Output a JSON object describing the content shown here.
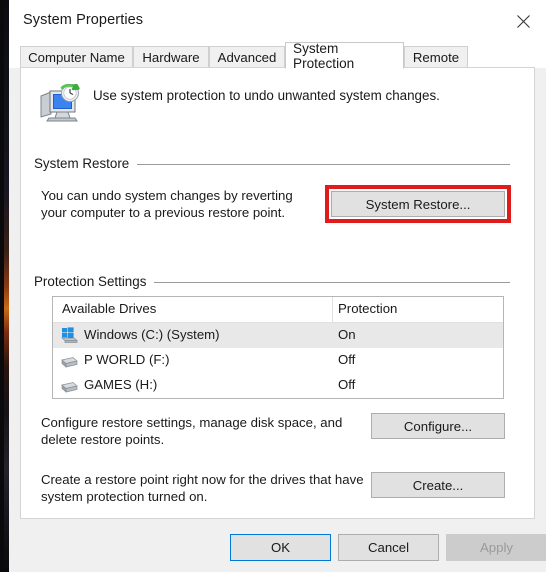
{
  "window": {
    "title": "System Properties",
    "close_icon": "close-icon"
  },
  "tabs": [
    {
      "label": "Computer Name",
      "selected": false
    },
    {
      "label": "Hardware",
      "selected": false
    },
    {
      "label": "Advanced",
      "selected": false
    },
    {
      "label": "System Protection",
      "selected": true
    },
    {
      "label": "Remote",
      "selected": false
    }
  ],
  "header": {
    "icon": "system-protection-icon",
    "description": "Use system protection to undo unwanted system changes."
  },
  "system_restore": {
    "group_label": "System Restore",
    "description": "You can undo system changes by reverting your computer to a previous restore point.",
    "button_label": "System Restore...",
    "highlight_color": "#e01b1b"
  },
  "protection_settings": {
    "group_label": "Protection Settings",
    "columns": [
      "Available Drives",
      "Protection"
    ],
    "rows": [
      {
        "icon": "windows-drive-icon",
        "name": "Windows (C:) (System)",
        "protection": "On",
        "selected": true
      },
      {
        "icon": "drive-icon",
        "name": "P WORLD (F:)",
        "protection": "Off",
        "selected": false
      },
      {
        "icon": "drive-icon",
        "name": "GAMES (H:)",
        "protection": "Off",
        "selected": false
      }
    ],
    "configure": {
      "description": "Configure restore settings, manage disk space, and delete restore points.",
      "button_label": "Configure..."
    },
    "create": {
      "description": "Create a restore point right now for the drives that have system protection turned on.",
      "button_label": "Create..."
    }
  },
  "footer": {
    "ok_label": "OK",
    "cancel_label": "Cancel",
    "apply_label": "Apply",
    "apply_disabled": true,
    "focus_color": "#0078d7"
  }
}
